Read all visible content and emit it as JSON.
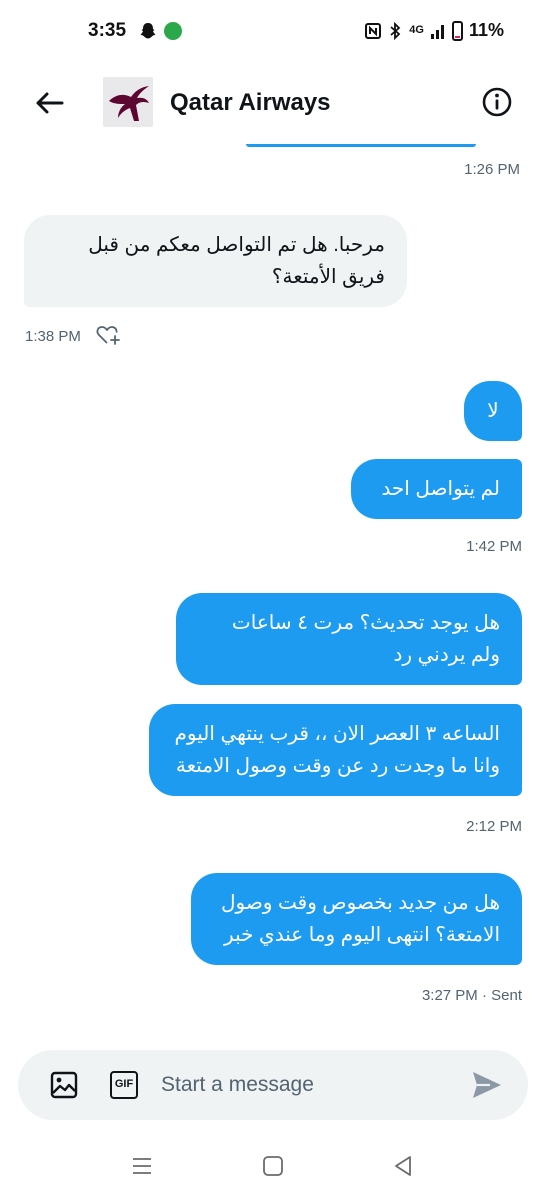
{
  "status_bar": {
    "time": "3:35",
    "network": "4G",
    "battery": "11%"
  },
  "header": {
    "title": "Qatar Airways"
  },
  "messages": [
    {
      "direction": "in",
      "text": "مرحبا. هل تم التواصل معكم من قبل فريق الأمتعة؟"
    },
    {
      "direction": "out",
      "text": "لا"
    },
    {
      "direction": "out",
      "text": "لم يتواصل احد"
    },
    {
      "direction": "out",
      "text": "هل يوجد تحديث؟ مرت ٤ ساعات ولم يردني رد"
    },
    {
      "direction": "out",
      "text": "الساعه ٣ العصر الان ،، قرب ينتهي اليوم وانا ما وجدت رد عن وقت وصول الامتعة"
    },
    {
      "direction": "out",
      "text": "هل من جديد بخصوص وقت وصول الامتعة؟ انتهى اليوم وما عندي خبر"
    }
  ],
  "timestamps": {
    "t0": "1:26 PM",
    "t1": "1:38 PM",
    "t2": "1:42 PM",
    "t3": "2:12 PM",
    "t4": "3:27 PM · Sent"
  },
  "composer": {
    "placeholder": "Start a message",
    "gif_label": "GIF"
  },
  "icons": {
    "back": "arrow-left-icon",
    "info": "info-icon",
    "react": "heart-plus-icon",
    "image": "image-icon",
    "gif": "gif-icon",
    "send": "send-icon"
  },
  "colors": {
    "accent": "#1d9bf0",
    "incoming_bg": "#eff3f4",
    "brand": "#5c0632"
  }
}
